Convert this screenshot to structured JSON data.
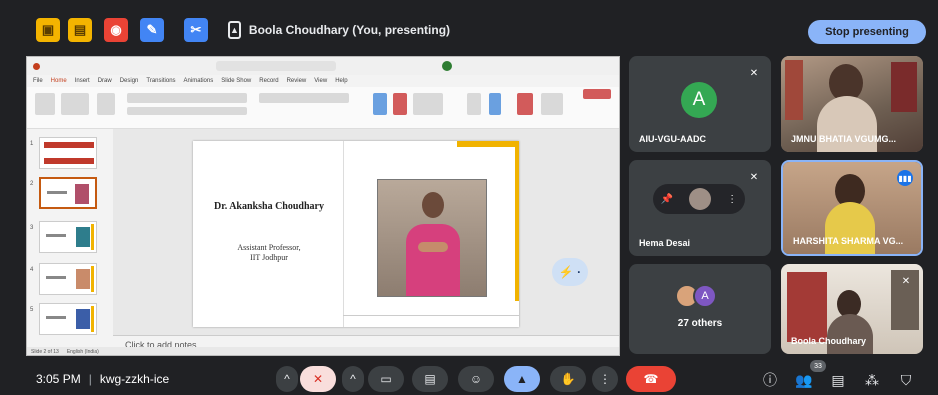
{
  "top_bar": {
    "presenting_text": "Boola Choudhary (You, presenting)",
    "stop_button": "Stop presenting",
    "taskbar_apps": [
      {
        "name": "app-1",
        "glyph": "▣",
        "color": "#f4b400"
      },
      {
        "name": "app-2",
        "glyph": "▤",
        "color": "#f4b400"
      },
      {
        "name": "app-3",
        "glyph": "◉",
        "color": "#ea4335"
      },
      {
        "name": "app-4",
        "glyph": "✎",
        "color": "#4285f4"
      },
      {
        "name": "app-5",
        "glyph": "✂",
        "color": "#4285f4"
      }
    ]
  },
  "presentation": {
    "slide_name": "Dr. Akanksha Choudhary",
    "slide_role_line1": "Assistant Professor,",
    "slide_role_line2": "IIT Jodhpur",
    "notes_placeholder": "Click to add notes"
  },
  "participants": [
    {
      "name": "AIU-VGU-AADC",
      "avatar_letter": "A",
      "muted": true
    },
    {
      "name": "JMNU BHATIA VGUMG...",
      "muted": false
    },
    {
      "name": "Hema Desai",
      "muted": true
    },
    {
      "name": "HARSHITA SHARMA VG...",
      "speaking": true
    },
    {
      "others_count_label": "27 others",
      "avatar_letter": "A"
    },
    {
      "name": "Boola Choudhary"
    }
  ],
  "bottom_bar": {
    "time": "3:05 PM",
    "meeting_code": "kwg-zzkh-ice",
    "participant_count": "33"
  }
}
